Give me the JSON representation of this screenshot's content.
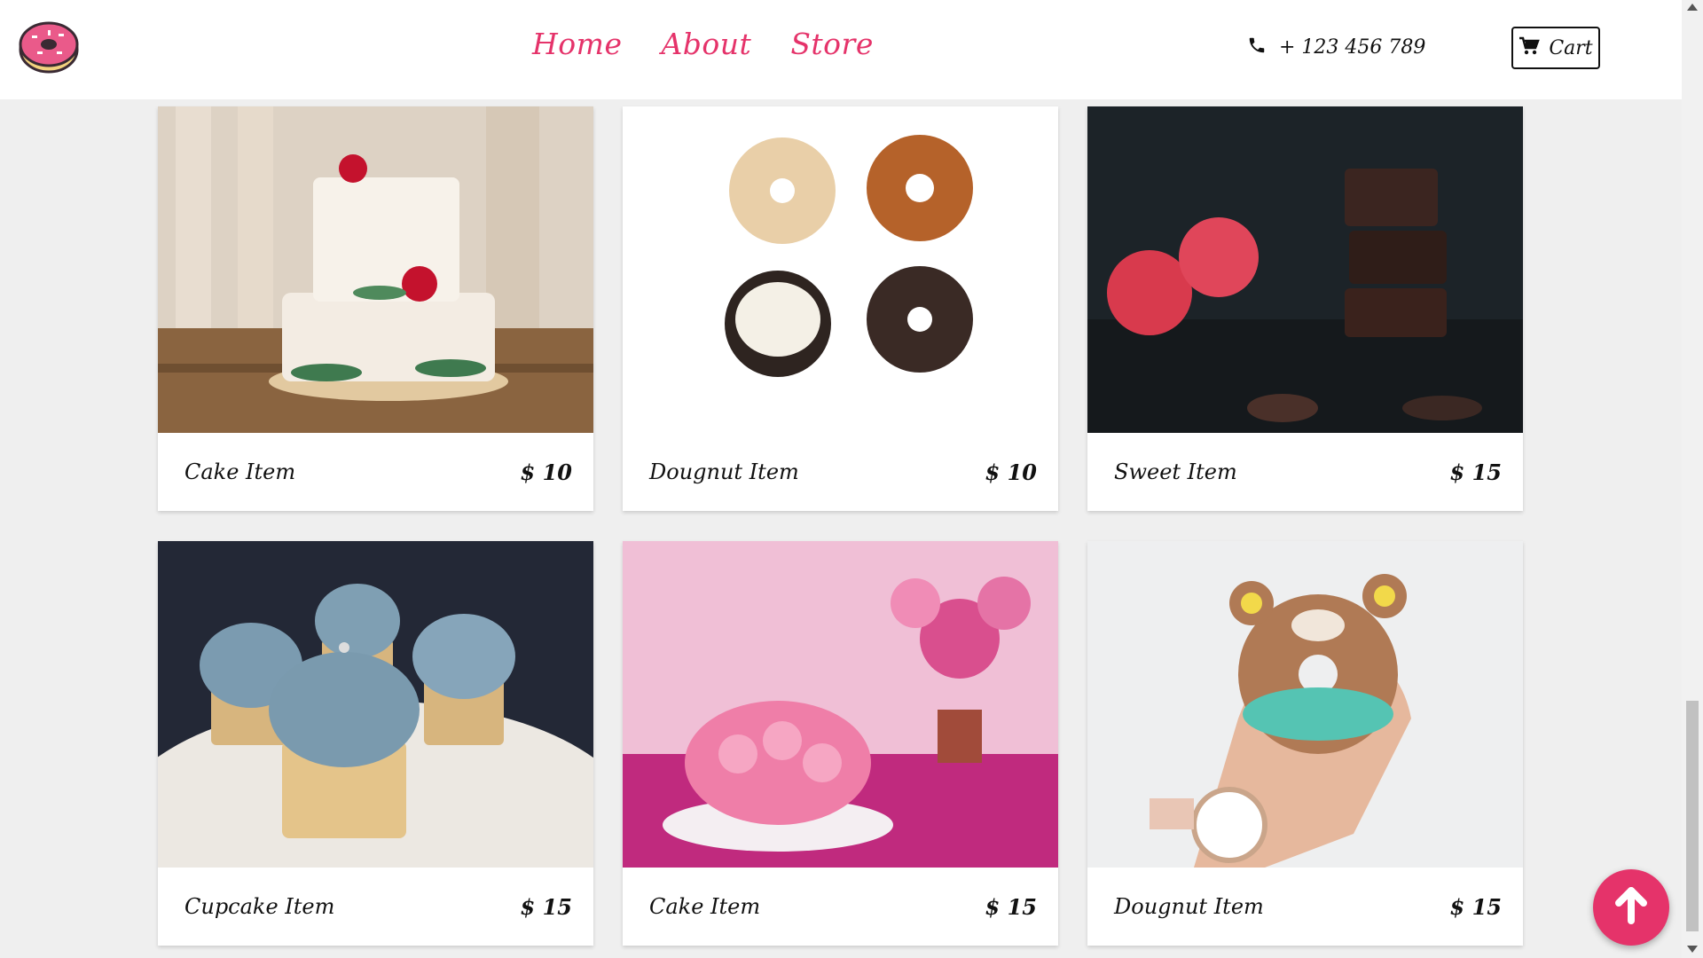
{
  "navbar": {
    "links": [
      "Home",
      "About",
      "Store"
    ],
    "phone": "+ 123 456 789",
    "cart_label": "Cart",
    "logo_icon": "donut-logo-icon",
    "accent_color": "#e5336a"
  },
  "products": [
    {
      "name": "Cake Item",
      "price": "$ 10",
      "image": "tiered-cake-with-flowers"
    },
    {
      "name": "Dougnut Item",
      "price": "$ 10",
      "image": "four-doughnuts"
    },
    {
      "name": "Sweet Item",
      "price": "$ 15",
      "image": "raspberries-and-chocolate"
    },
    {
      "name": "Cupcake Item",
      "price": "$ 15",
      "image": "blue-frosted-cupcakes"
    },
    {
      "name": "Cake Item",
      "price": "$ 15",
      "image": "pink-rose-cake"
    },
    {
      "name": "Dougnut Item",
      "price": "$ 15",
      "image": "bear-doughnut-in-hand"
    }
  ],
  "back_to_top_icon": "arrow-up-icon"
}
